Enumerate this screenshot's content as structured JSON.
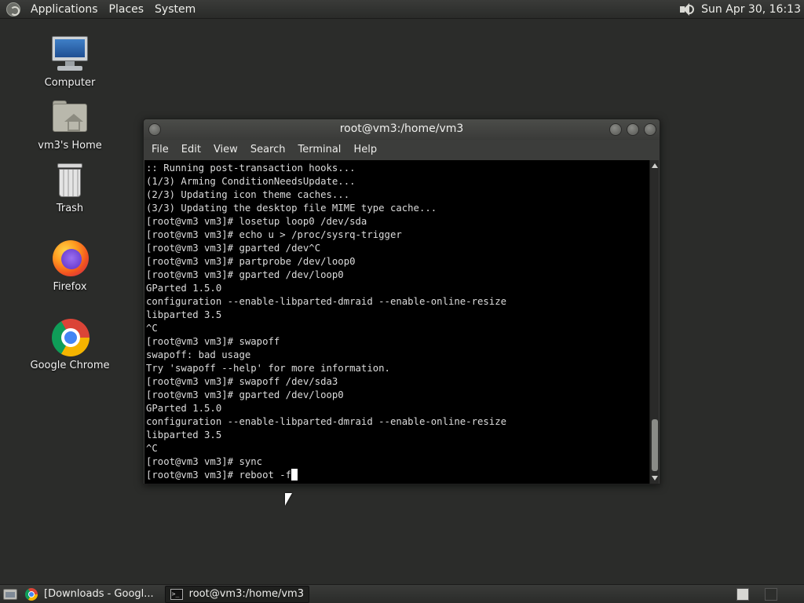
{
  "top_panel": {
    "menus": [
      "Applications",
      "Places",
      "System"
    ],
    "clock": "Sun Apr 30, 16:13",
    "volume_icon": "speaker-volume-icon",
    "logo_icon": "distro-logo-icon"
  },
  "desktop": {
    "icons": [
      {
        "label": "Computer",
        "icon": "computer-icon"
      },
      {
        "label": "vm3's Home",
        "icon": "home-folder-icon"
      },
      {
        "label": "Trash",
        "icon": "trash-icon"
      },
      {
        "label": "Firefox",
        "icon": "firefox-icon"
      },
      {
        "label": "Google Chrome",
        "icon": "chrome-icon"
      }
    ]
  },
  "terminal": {
    "title": "root@vm3:/home/vm3",
    "menu": [
      "File",
      "Edit",
      "View",
      "Search",
      "Terminal",
      "Help"
    ],
    "lines": [
      ":: Running post-transaction hooks...",
      "(1/3) Arming ConditionNeedsUpdate...",
      "(2/3) Updating icon theme caches...",
      "(3/3) Updating the desktop file MIME type cache...",
      "[root@vm3 vm3]# losetup loop0 /dev/sda",
      "[root@vm3 vm3]# echo u > /proc/sysrq-trigger",
      "[root@vm3 vm3]# gparted /dev^C",
      "[root@vm3 vm3]# partprobe /dev/loop0",
      "[root@vm3 vm3]# gparted /dev/loop0",
      "GParted 1.5.0",
      "configuration --enable-libparted-dmraid --enable-online-resize",
      "libparted 3.5",
      "^C",
      "[root@vm3 vm3]# swapoff",
      "swapoff: bad usage",
      "Try 'swapoff --help' for more information.",
      "[root@vm3 vm3]# swapoff /dev/sda3",
      "[root@vm3 vm3]# gparted /dev/loop0",
      "GParted 1.5.0",
      "configuration --enable-libparted-dmraid --enable-online-resize",
      "libparted 3.5",
      "^C",
      "[root@vm3 vm3]# sync"
    ],
    "prompt_line": "[root@vm3 vm3]# reboot -f"
  },
  "taskbar": {
    "items": [
      {
        "label": "[Downloads - Googl...",
        "icon": "chrome-icon",
        "active": false
      },
      {
        "label": "root@vm3:/home/vm3",
        "icon": "terminal-icon",
        "active": true
      }
    ]
  },
  "colors": {
    "desktop_bg": "#2b2c2a",
    "panel_bg": "#2f302e",
    "terminal_bg": "#000000",
    "terminal_fg": "#dcdcdc"
  }
}
